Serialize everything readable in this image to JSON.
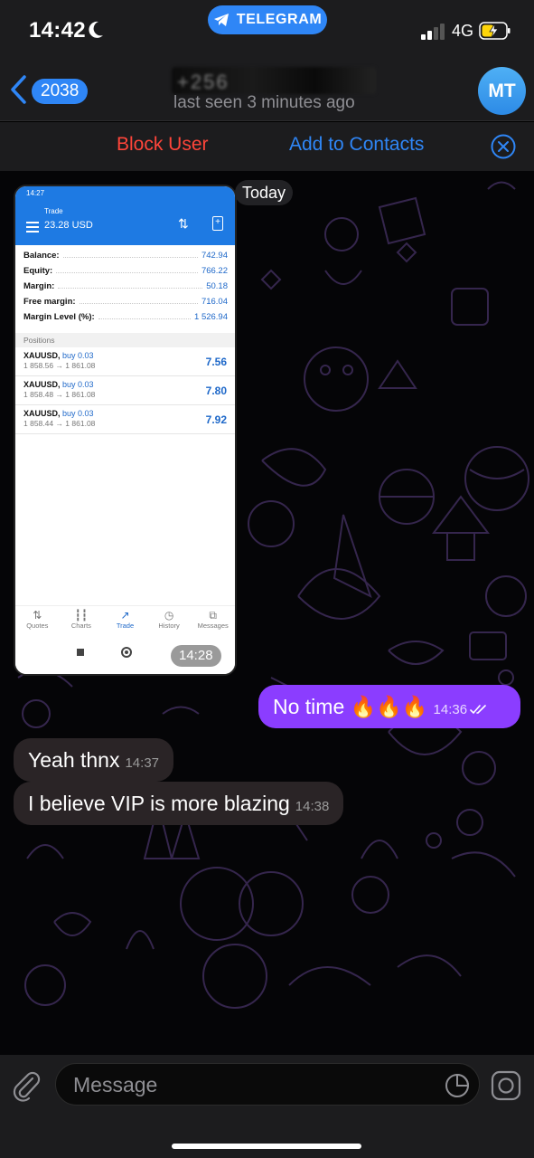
{
  "status_bar": {
    "time": "14:42",
    "moon_icon": "moon-icon",
    "app_pill": "TELEGRAM",
    "network": "4G",
    "battery_icon": "battery-charging-icon"
  },
  "header": {
    "back_count": "2038",
    "contact_name_redacted": "+256",
    "last_seen": "last seen 3 minutes ago",
    "avatar_initials": "MT"
  },
  "action_bar": {
    "block_user": "Block User",
    "add_to_contacts": "Add to Contacts"
  },
  "chat": {
    "date_separator": "Today",
    "image_message": {
      "time": "14:28",
      "screenshot": {
        "status_time": "14:27",
        "title": "Trade",
        "balance_header": "23.28 USD",
        "account": [
          {
            "label": "Balance:",
            "value": "742.94"
          },
          {
            "label": "Equity:",
            "value": "766.22"
          },
          {
            "label": "Margin:",
            "value": "50.18"
          },
          {
            "label": "Free margin:",
            "value": "716.04"
          },
          {
            "label": "Margin Level (%):",
            "value": "1 526.94"
          }
        ],
        "positions_header": "Positions",
        "positions": [
          {
            "symbol": "XAUUSD,",
            "side": "buy 0.03",
            "prices": "1 858.56 → 1 861.08",
            "pl": "7.56"
          },
          {
            "symbol": "XAUUSD,",
            "side": "buy 0.03",
            "prices": "1 858.48 → 1 861.08",
            "pl": "7.80"
          },
          {
            "symbol": "XAUUSD,",
            "side": "buy 0.03",
            "prices": "1 858.44 → 1 861.08",
            "pl": "7.92"
          }
        ],
        "tabs": [
          "Quotes",
          "Charts",
          "Trade",
          "History",
          "Messages"
        ],
        "active_tab": "Trade"
      }
    },
    "messages": [
      {
        "direction": "out",
        "text": "No time 🔥🔥🔥",
        "time": "14:36",
        "status": "read"
      },
      {
        "direction": "in",
        "text": "Yeah thnx",
        "time": "14:37"
      },
      {
        "direction": "in",
        "text": "I believe VIP is more blazing",
        "time": "14:38"
      }
    ]
  },
  "composer": {
    "placeholder": "Message"
  },
  "colors": {
    "accent": "#2f86f6",
    "outgoing_bubble": "#8b3dff",
    "incoming_bubble": "#2a2426",
    "block_red": "#ff453a"
  }
}
